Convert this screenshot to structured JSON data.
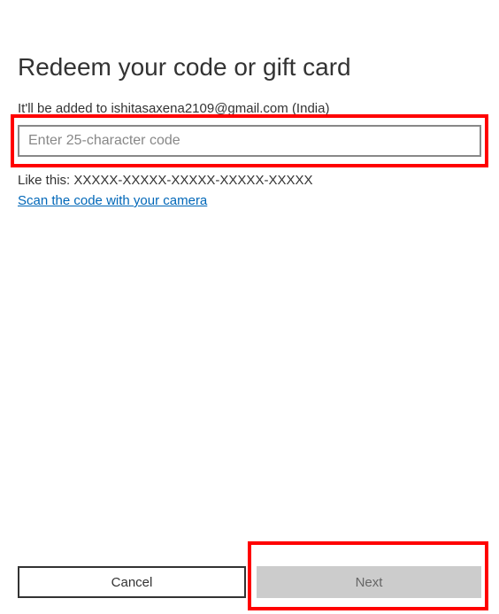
{
  "heading": "Redeem your code or gift card",
  "subtext": "It'll be added to ishitasaxena2109@gmail.com (India)",
  "input": {
    "placeholder": "Enter 25-character code",
    "value": ""
  },
  "example": "Like this: XXXXX-XXXXX-XXXXX-XXXXX-XXXXX",
  "scan_link": "Scan the code with your camera",
  "buttons": {
    "cancel": "Cancel",
    "next": "Next"
  }
}
